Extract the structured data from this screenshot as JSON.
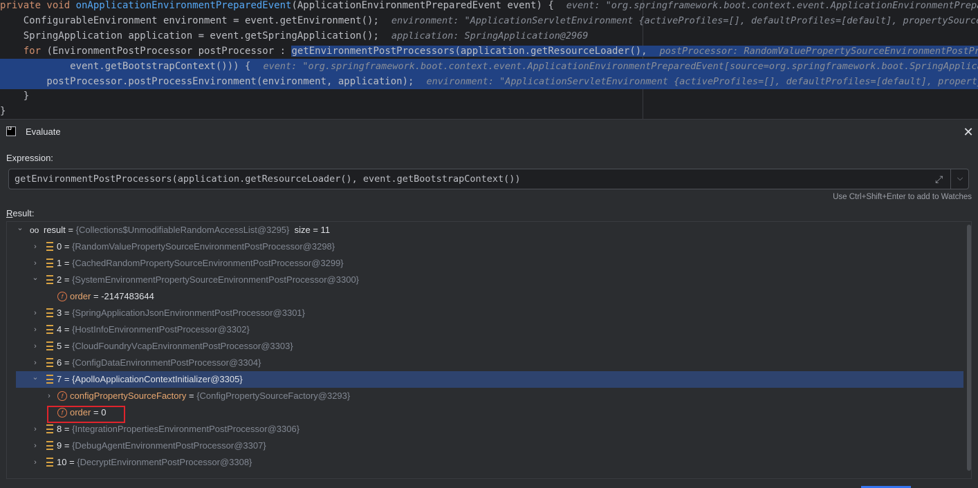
{
  "editor": {
    "lines": [
      {
        "kw": "private void ",
        "fn": "onApplicationEnvironmentPreparedEvent",
        "rest": "(ApplicationEnvironmentPreparedEvent event) {",
        "hint": "event: \"org.springframework.boot.context.event.ApplicationEnvironmentPreparedEv"
      },
      {
        "code": "    ConfigurableEnvironment environment = event.getEnvironment();",
        "hint": "environment: \"ApplicationServletEnvironment {activeProfiles=[], defaultProfiles=[default], propertySources=[C"
      },
      {
        "code": "    SpringApplication application = event.getSpringApplication();",
        "hint": "application: SpringApplication@2969"
      },
      {
        "kw": "    for ",
        "pre": "(EnvironmentPostProcessor postProcessor : ",
        "sel": "getEnvironmentPostProcessors(application.getResourceLoader(),",
        "hint": "postProcessor: RandomValuePropertySourceEnvironmentPostProcesso"
      },
      {
        "code": "            event.getBootstrapContext())) {",
        "hint": "event: \"org.springframework.boot.context.event.ApplicationEnvironmentPreparedEvent[source=org.springframework.boot.SpringApplicatio"
      },
      {
        "code": "        postProcessor.postProcessEnvironment(environment, application);",
        "hint": "environment: \"ApplicationServletEnvironment {activeProfiles=[], defaultProfiles=[default], propertySour"
      },
      {
        "code": "    }"
      },
      {
        "code": "}"
      }
    ]
  },
  "dialog": {
    "title": "Evaluate",
    "close": "✕",
    "expression_label": "Expression:",
    "expression": "getEnvironmentPostProcessors(application.getResourceLoader(), event.getBootstrapContext())",
    "watch_hint": "Use Ctrl+Shift+Enter to add to Watches",
    "result_label_underlined": "R",
    "result_label_rest": "esult:"
  },
  "tree": [
    {
      "depth": 0,
      "chev": "expanded",
      "icon": "glasses-icon",
      "name": "result",
      "eq": " = ",
      "val": "{Collections$UnmodifiableRandomAccessList@3295}",
      "extra": "  size = 11"
    },
    {
      "depth": 1,
      "chev": "collapsed",
      "icon": "list-icon",
      "name": "0",
      "eq": " = ",
      "val": "{RandomValuePropertySourceEnvironmentPostProcessor@3298}"
    },
    {
      "depth": 1,
      "chev": "collapsed",
      "icon": "list-icon",
      "name": "1",
      "eq": " = ",
      "val": "{CachedRandomPropertySourceEnvironmentPostProcessor@3299}"
    },
    {
      "depth": 1,
      "chev": "expanded",
      "icon": "list-icon",
      "name": "2",
      "eq": " = ",
      "val": "{SystemEnvironmentPropertySourceEnvironmentPostProcessor@3300}"
    },
    {
      "depth": 2,
      "chev": "none",
      "icon": "field-icon",
      "name": "order",
      "eq": " = ",
      "num": "-2147483644",
      "field": true
    },
    {
      "depth": 1,
      "chev": "collapsed",
      "icon": "list-icon",
      "name": "3",
      "eq": " = ",
      "val": "{SpringApplicationJsonEnvironmentPostProcessor@3301}"
    },
    {
      "depth": 1,
      "chev": "collapsed",
      "icon": "list-icon",
      "name": "4",
      "eq": " = ",
      "val": "{HostInfoEnvironmentPostProcessor@3302}"
    },
    {
      "depth": 1,
      "chev": "collapsed",
      "icon": "list-icon",
      "name": "5",
      "eq": " = ",
      "val": "{CloudFoundryVcapEnvironmentPostProcessor@3303}"
    },
    {
      "depth": 1,
      "chev": "collapsed",
      "icon": "list-icon",
      "name": "6",
      "eq": " = ",
      "val": "{ConfigDataEnvironmentPostProcessor@3304}"
    },
    {
      "depth": 1,
      "chev": "expanded",
      "icon": "list-icon",
      "name": "7",
      "eq": " = ",
      "val": "{ApolloApplicationContextInitializer@3305}",
      "selected": true
    },
    {
      "depth": 2,
      "chev": "collapsed",
      "icon": "field-icon",
      "name": "configPropertySourceFactory",
      "eq": " = ",
      "val": "{ConfigPropertySourceFactory@3293}",
      "field": true
    },
    {
      "depth": 2,
      "chev": "none",
      "icon": "field-icon",
      "name": "order",
      "eq": " = ",
      "num": "0",
      "field": true
    },
    {
      "depth": 1,
      "chev": "collapsed",
      "icon": "list-icon",
      "name": "8",
      "eq": " = ",
      "val": "{IntegrationPropertiesEnvironmentPostProcessor@3306}"
    },
    {
      "depth": 1,
      "chev": "collapsed",
      "icon": "list-icon",
      "name": "9",
      "eq": " = ",
      "val": "{DebugAgentEnvironmentPostProcessor@3307}"
    },
    {
      "depth": 1,
      "chev": "collapsed",
      "icon": "list-icon",
      "name": "10",
      "eq": " = ",
      "val": "{DecryptEnvironmentPostProcessor@3308}"
    }
  ],
  "colors": {
    "selection": "#214283",
    "tree_selected": "#2e436e",
    "highlight_box": "#e0242c"
  }
}
